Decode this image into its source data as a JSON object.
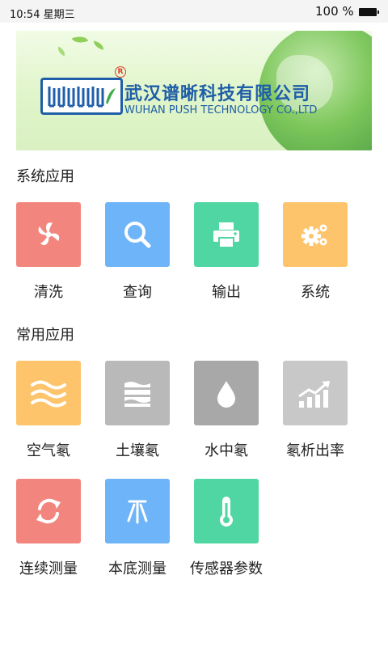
{
  "status_bar": {
    "time": "10:54 星期三",
    "battery": "100 %"
  },
  "banner": {
    "company_cn": "武汉谱晰科技有限公司",
    "company_en": "WUHAN PUSH TECHNOLOGY CO.,LTD",
    "registered_mark": "R"
  },
  "sections": [
    {
      "title": "系统应用",
      "items": [
        {
          "label": "清洗",
          "icon": "fan-icon",
          "color": "#f2867e"
        },
        {
          "label": "查询",
          "icon": "search-icon",
          "color": "#6eb4f8"
        },
        {
          "label": "输出",
          "icon": "printer-icon",
          "color": "#4fd6a2"
        },
        {
          "label": "系统",
          "icon": "gears-icon",
          "color": "#fdc46c"
        }
      ]
    },
    {
      "title": "常用应用",
      "items": [
        {
          "label": "空气氡",
          "icon": "air-waves-icon",
          "color": "#fdc46c"
        },
        {
          "label": "土壤氡",
          "icon": "soil-layers-icon",
          "color": "#b9b9b9"
        },
        {
          "label": "水中氡",
          "icon": "water-drop-icon",
          "color": "#a8a8a8"
        },
        {
          "label": "氡析出率",
          "icon": "rising-chart-icon",
          "color": "#c8c8c8"
        },
        {
          "label": "连续测量",
          "icon": "refresh-icon",
          "color": "#f2867e"
        },
        {
          "label": "本底测量",
          "icon": "tripod-icon",
          "color": "#6eb4f8"
        },
        {
          "label": "传感器参数",
          "icon": "thermometer-icon",
          "color": "#4fd6a2"
        }
      ]
    }
  ]
}
